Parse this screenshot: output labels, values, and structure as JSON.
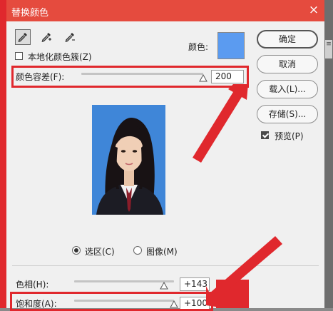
{
  "window": {
    "title": "替换颜色",
    "close_glyph": "×"
  },
  "side_tab": "≡",
  "tools": [
    {
      "name": "eyedropper",
      "selected": true
    },
    {
      "name": "eyedropper-plus",
      "selected": false
    },
    {
      "name": "eyedropper-minus",
      "selected": false
    }
  ],
  "localized_clusters": {
    "label": "本地化颜色簇(Z)",
    "checked": false
  },
  "color": {
    "label": "颜色:",
    "swatch_hex": "#5b9bf0"
  },
  "fuzziness": {
    "label": "颜色容差(F):",
    "value": "200",
    "fraction": 1.0
  },
  "buttons": {
    "ok": "确定",
    "cancel": "取消",
    "load": "载入(L)...",
    "save": "存储(S)..."
  },
  "preview": {
    "label": "预览(P)",
    "checked": true
  },
  "view": {
    "selection": {
      "label": "选区(C)",
      "selected": true
    },
    "image": {
      "label": "图像(M)",
      "selected": false
    }
  },
  "hue": {
    "label": "色相(H):",
    "value": "+143",
    "fraction": 0.897
  },
  "saturation": {
    "label": "饱和度(A):",
    "value": "+100",
    "fraction": 1.0
  },
  "colors": {
    "titlebar": "#e54b3e",
    "highlight": "#e0282d",
    "photo_bg": "#3f86d8"
  }
}
